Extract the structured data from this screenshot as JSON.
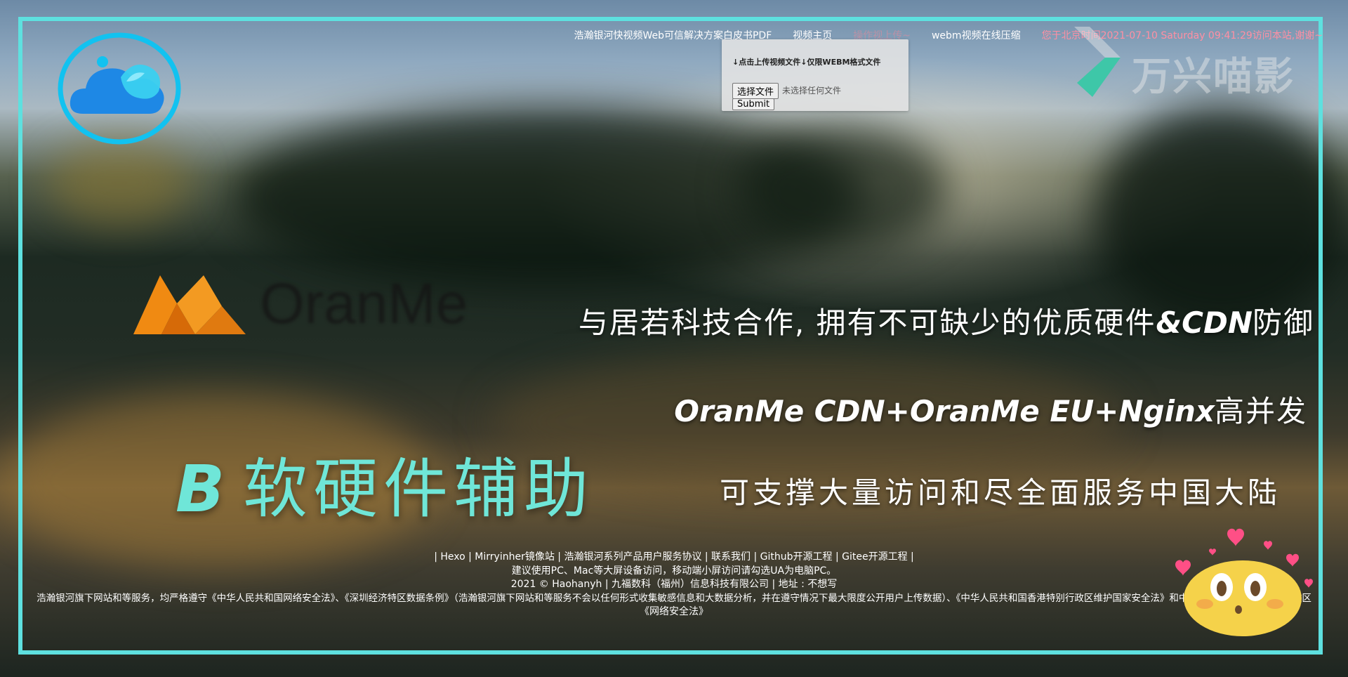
{
  "nav": {
    "items": [
      "浩瀚银河快视频Web可信解决方案白皮书PDF",
      "视频主页",
      "操作视上传~",
      "webm视频在线压缩",
      "您于北京时间2021-07-10 Saturday 09:41:29访问本站,谢谢~"
    ]
  },
  "upload": {
    "hint": "↓点击上传视频文件↓仅限WEBM格式文件",
    "choose_label": "选择文件",
    "no_file_text": "未选择任何文件",
    "submit_label": "Submit"
  },
  "brand": {
    "wanxing": "万兴喵影",
    "oranme": "OranMe"
  },
  "hero": {
    "line1_prefix": "与居若科技合作, 拥有不可缺少的优质硬件",
    "line1_em": "&CDN",
    "line1_suffix": "防御",
    "line2_em": "OranMe CDN+OranMe EU+Nginx",
    "line2_suffix": "高并发",
    "line3": "可支撑大量访问和尽全面服务中国大陆",
    "title_letter": "B",
    "title_text": "软硬件辅助"
  },
  "footer": {
    "links": "| Hexo | Mirryinher镜像站 | 浩瀚银河系列产品用户服务协议 | 联系我们 | Github开源工程 | Gitee开源工程 |",
    "advice": "建议使用PC、Mac等大屏设备访问，移动端小屏访问请勾选UA为电脑PC。",
    "copyright": "2021 © Haohanyh | 九福数科（福州）信息科技有限公司 | 地址 : 不想写",
    "legal": "浩瀚银河旗下网站和等服务，均严格遵守《中华人民共和国网络安全法》、《深圳经济特区数据条例》（浩瀚银河旗下网站和等服务不会以任何形式收集敏感信息和大数据分析，并在遵守情况下最大限度公开用户上传数据）、《中华人民共和国香港特别行政区维护国家安全法》和中华人民共和国澳门特别行政区",
    "legal2": "《网络安全法》"
  },
  "colors": {
    "frame": "#5ee0df",
    "title": "#6fe6d8",
    "cloud": "#1e88e5",
    "ring": "#12c2f0",
    "oranme_orange": "#f08a12",
    "wanxing_green": "#3ec7a8",
    "nav_pink": "#ff8fa3",
    "mascot": "#f5d24a"
  },
  "icons": [
    "cloud-logo-icon",
    "oranme-logo-icon",
    "wanxing-logo-icon",
    "emoji-mascot-icon",
    "heart-icon"
  ]
}
